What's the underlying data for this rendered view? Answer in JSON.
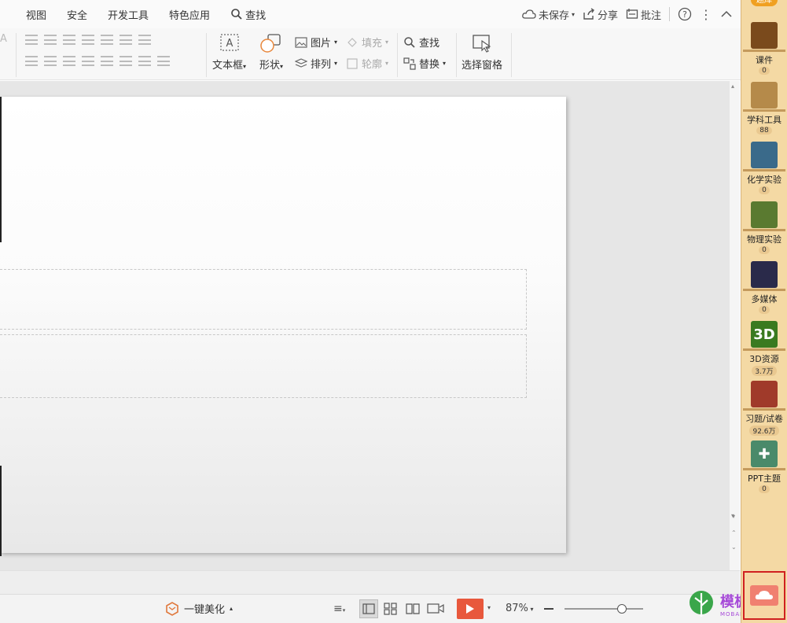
{
  "menu": {
    "items": [
      "视图",
      "安全",
      "开发工具",
      "特色应用"
    ],
    "search": "查找",
    "unsaved": "未保存",
    "share": "分享",
    "comment": "批注"
  },
  "ribbon": {
    "textbox": "文本框",
    "shape": "形状",
    "picture": "图片",
    "fill": "填充",
    "arrange": "排列",
    "outline": "轮廓",
    "find": "查找",
    "replace": "替换",
    "selection_pane": "选择窗格"
  },
  "status": {
    "beautify": "一键美化",
    "zoom": "87%",
    "zoom_fraction": 0.73
  },
  "sidebar": {
    "badge": "题库",
    "items": [
      {
        "label": "课件",
        "count": "0",
        "icon": "courseware-icon",
        "color": "#7a4a1c",
        "glyph": ""
      },
      {
        "label": "学科工具",
        "count": "88",
        "icon": "subject-tools-icon",
        "color": "#b58a4a",
        "glyph": ""
      },
      {
        "label": "化学实验",
        "count": "0",
        "icon": "chemistry-icon",
        "color": "#3a6a8a",
        "glyph": ""
      },
      {
        "label": "物理实验",
        "count": "0",
        "icon": "physics-icon",
        "color": "#5a7a30",
        "glyph": ""
      },
      {
        "label": "多媒体",
        "count": "0",
        "icon": "multimedia-icon",
        "color": "#2a2a4a",
        "glyph": ""
      },
      {
        "label": "3D资源",
        "count": "3.7万",
        "icon": "3d-resource-icon",
        "color": "#3a7a20",
        "glyph": "3D"
      },
      {
        "label": "习题/试卷",
        "count": "92.6万",
        "icon": "exercise-icon",
        "color": "#a03a2a",
        "glyph": ""
      },
      {
        "label": "PPT主题",
        "count": "0",
        "icon": "ppt-theme-icon",
        "color": "#4a8a6a",
        "glyph": "✚"
      }
    ]
  },
  "watermark": {
    "name": "模板馆",
    "sub": "MOBANGUAN"
  },
  "colors": {
    "accent": "#e8583c",
    "sidebar_bg": "#f4d9a4",
    "slideshow": "#e8583c"
  }
}
